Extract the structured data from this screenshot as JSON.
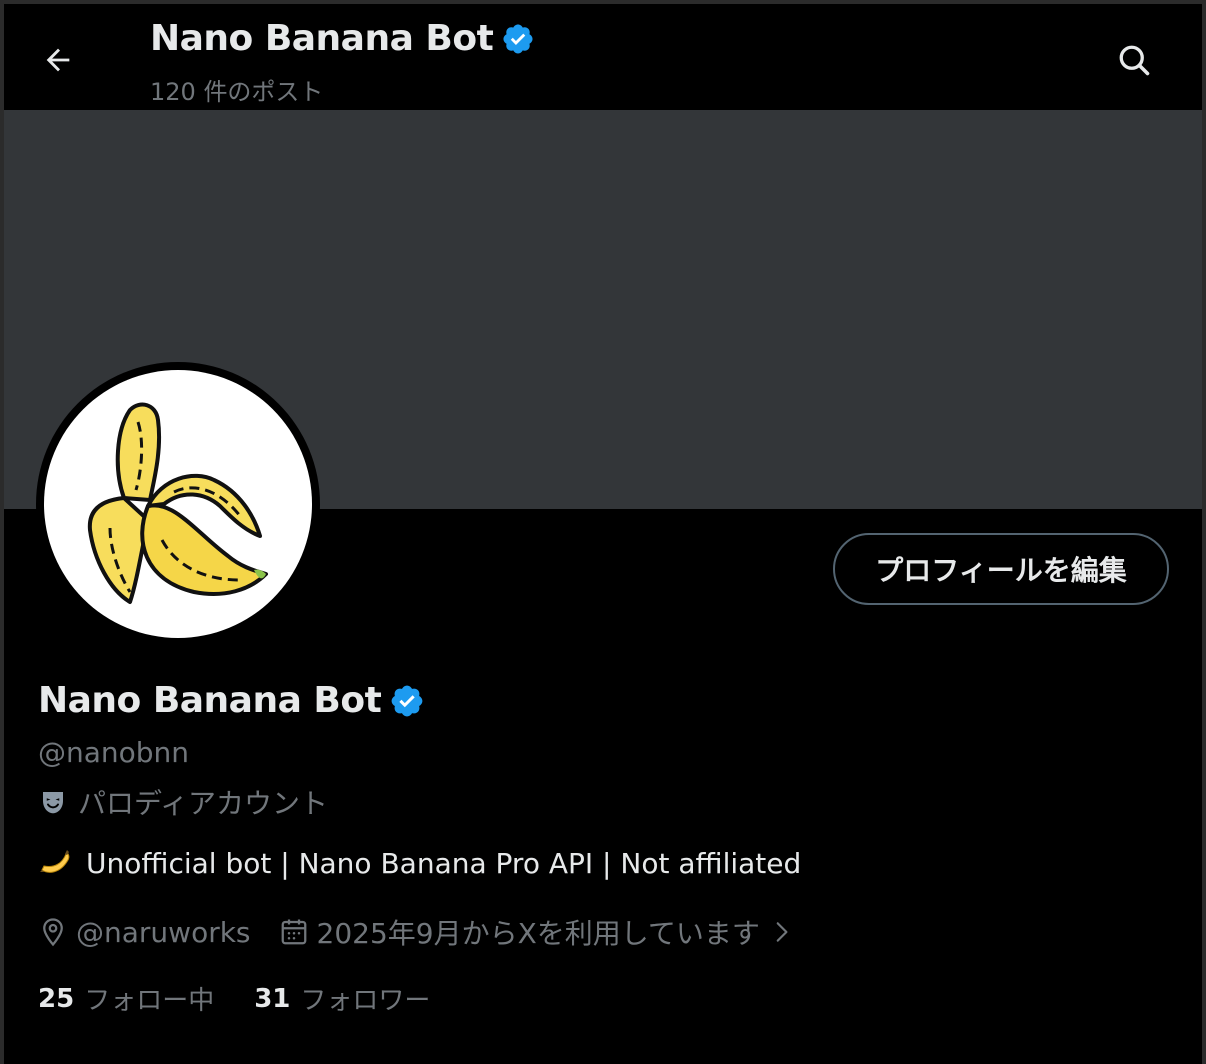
{
  "header": {
    "title": "Nano Banana Bot",
    "post_count": "120 件のポスト"
  },
  "profile": {
    "edit_button": "プロフィールを編集",
    "display_name": "Nano Banana Bot",
    "handle": "@nanobnn",
    "parody_label": "パロディアカウント",
    "bio": "Unofficial bot | Nano Banana Pro API | Not affiliated",
    "location": "@naruworks",
    "joined": "2025年9月からXを利用しています"
  },
  "stats": {
    "following_count": "25",
    "following_label": "フォロー中",
    "followers_count": "31",
    "followers_label": "フォロワー"
  },
  "icons": {
    "back": "back-arrow-icon",
    "search": "search-icon",
    "verified": "verified-badge-icon",
    "parody": "theater-mask-icon",
    "bio_emoji": "banana-emoji-icon",
    "location": "location-pin-icon",
    "calendar": "calendar-icon",
    "chevron": "chevron-right-icon"
  },
  "colors": {
    "background": "#000000",
    "banner": "#333639",
    "text_primary": "#e7e9ea",
    "text_secondary": "#71767b",
    "verified_blue": "#1d9bf0",
    "button_border": "#536471"
  }
}
